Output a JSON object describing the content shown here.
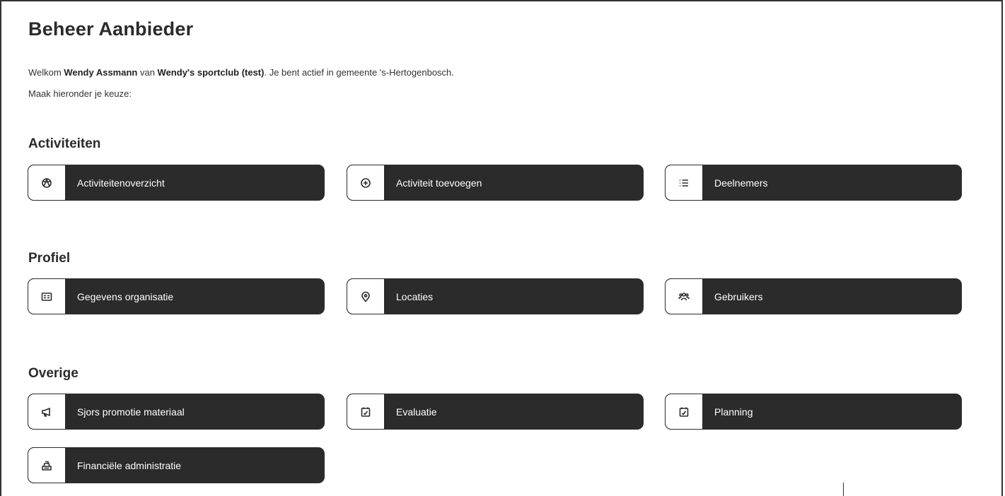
{
  "page": {
    "title": "Beheer Aanbieder"
  },
  "intro": {
    "welcome": "Welkom ",
    "user_name": "Wendy Assmann",
    "van": " van ",
    "org_name": "Wendy's sportclub (test)",
    "rest": ". Je bent actief in gemeente 's-Hertogenbosch.",
    "instruction": "Maak hieronder je keuze:"
  },
  "sections": {
    "activiteiten": {
      "title": "Activiteiten",
      "tiles": [
        {
          "label": "Activiteitenoverzicht",
          "icon": "sports-ball-icon"
        },
        {
          "label": "Activiteit toevoegen",
          "icon": "plus-circle-icon"
        },
        {
          "label": "Deelnemers",
          "icon": "list-icon"
        }
      ]
    },
    "profiel": {
      "title": "Profiel",
      "tiles": [
        {
          "label": "Gegevens organisatie",
          "icon": "id-card-icon"
        },
        {
          "label": "Locaties",
          "icon": "map-pin-icon"
        },
        {
          "label": "Gebruikers",
          "icon": "users-icon"
        }
      ]
    },
    "overige": {
      "title": "Overige",
      "tiles": [
        {
          "label": "Sjors promotie materiaal",
          "icon": "megaphone-icon"
        },
        {
          "label": "Evaluatie",
          "icon": "calendar-check-icon"
        },
        {
          "label": "Planning",
          "icon": "calendar-check-icon"
        },
        {
          "label": "Financiële administratie",
          "icon": "cash-register-icon"
        }
      ]
    }
  },
  "colors": {
    "tile_bg": "#2b2b2b",
    "tile_text": "#ffffff",
    "icon_bg": "#ffffff"
  }
}
